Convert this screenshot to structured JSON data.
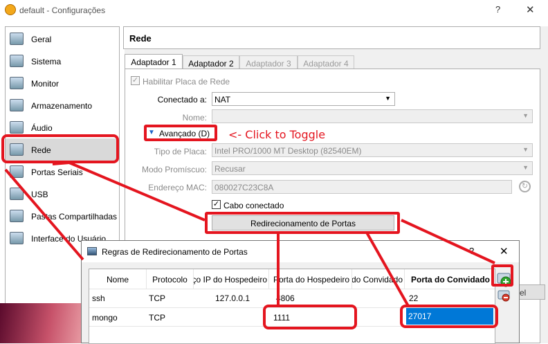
{
  "window": {
    "title": "default - Configurações",
    "help": "?",
    "close": "✕"
  },
  "sidebar": {
    "items": [
      {
        "label": "Geral",
        "icon": "general-icon"
      },
      {
        "label": "Sistema",
        "icon": "system-icon"
      },
      {
        "label": "Monitor",
        "icon": "monitor-icon"
      },
      {
        "label": "Armazenamento",
        "icon": "storage-icon"
      },
      {
        "label": "Áudio",
        "icon": "audio-icon"
      },
      {
        "label": "Rede",
        "icon": "network-icon"
      },
      {
        "label": "Portas Seriais",
        "icon": "serial-icon"
      },
      {
        "label": "USB",
        "icon": "usb-icon"
      },
      {
        "label": "Pastas Compartilhadas",
        "icon": "shared-folder-icon"
      },
      {
        "label": "Interface do Usuário",
        "icon": "ui-icon"
      }
    ],
    "selected": "Rede"
  },
  "section": {
    "title": "Rede"
  },
  "tabs": [
    "Adaptador 1",
    "Adaptador 2",
    "Adaptador 3",
    "Adaptador 4"
  ],
  "adapter": {
    "enable_label": "Habilitar Placa de Rede",
    "attached_label": "Conectado a:",
    "attached_value": "NAT",
    "name_label": "Nome:",
    "name_value": "",
    "advanced_label": "Avançado (D)",
    "type_label": "Tipo de Placa:",
    "type_value": "Intel PRO/1000 MT Desktop (82540EM)",
    "promisc_label": "Modo Promíscuo:",
    "promisc_value": "Recusar",
    "mac_label": "Endereço MAC:",
    "mac_value": "080027C23C8A",
    "cable_label": "Cabo conectado",
    "port_forward_button": "Redirecionamento de Portas",
    "cancel_partial": "cel"
  },
  "annotation": "<- Click to Toggle",
  "dialog": {
    "title": "Regras de Redirecionamento de Portas",
    "help": "?",
    "close": "✕",
    "columns": [
      "Nome",
      "Protocolo",
      "Endereço IP do Hospedeiro",
      "Porta do Hospedeiro",
      "IP do Convidado",
      "Porta do Convidado"
    ],
    "rows": [
      {
        "name": "ssh",
        "protocol": "TCP",
        "host_ip": "127.0.0.1",
        "host_port": "4806",
        "guest_ip": "",
        "guest_port": "22"
      },
      {
        "name": "mongo",
        "protocol": "TCP",
        "host_ip": "",
        "host_port": "1111",
        "guest_ip": "",
        "guest_port": "27017"
      }
    ]
  },
  "colors": {
    "accent": "#0078d7",
    "annotation": "#e4151f",
    "selected": "#d9d9d9"
  }
}
